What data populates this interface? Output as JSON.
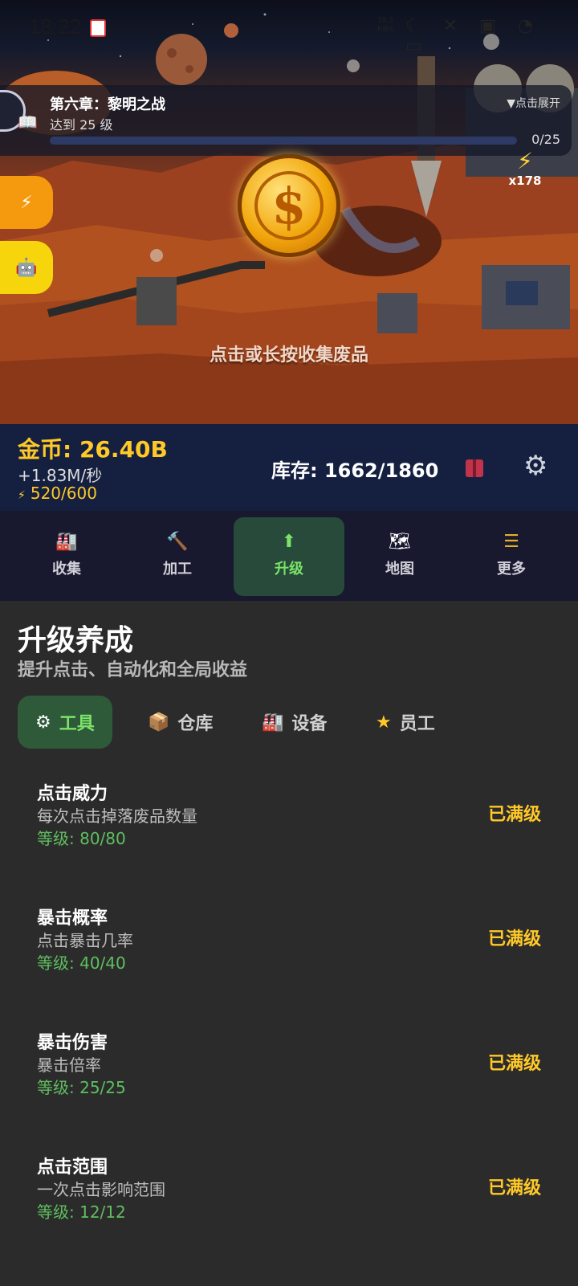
{
  "status_bar": {
    "time": "18:22",
    "net_speed_top": "19.3",
    "net_speed_bottom": "KB/s"
  },
  "chapter": {
    "title": "第六章：黎明之战",
    "goal": "达到 25 级",
    "expand_label": "▼点击展开",
    "progress_text": "0/25",
    "progress_fraction": 0
  },
  "energy_boost": {
    "multiplier": "x178"
  },
  "scene": {
    "collect_hint": "点击或长按收集废品"
  },
  "stats": {
    "gold": "金币: 26.40B",
    "rate": "+1.83M/秒",
    "energy": "520/600",
    "stock": "库存: 1662/1860"
  },
  "nav": {
    "items": [
      {
        "label": "收集",
        "icon": "factory-icon"
      },
      {
        "label": "加工",
        "icon": "hammer-icon"
      },
      {
        "label": "升级",
        "icon": "up-arrow-icon"
      },
      {
        "label": "地图",
        "icon": "map-icon"
      },
      {
        "label": "更多",
        "icon": "menu-icon"
      }
    ],
    "active_index": 2
  },
  "panel": {
    "title": "升级养成",
    "subtitle": "提升点击、自动化和全局收益",
    "tabs": [
      {
        "label": "工具",
        "icon": "gear-icon"
      },
      {
        "label": "仓库",
        "icon": "box-icon"
      },
      {
        "label": "设备",
        "icon": "machine-icon"
      },
      {
        "label": "员工",
        "icon": "star-icon"
      }
    ],
    "active_tab": 0,
    "upgrades": [
      {
        "name": "点击威力",
        "desc": "每次点击掉落废品数量",
        "level": "等级: 80/80",
        "status": "已满级"
      },
      {
        "name": "暴击概率",
        "desc": "点击暴击几率",
        "level": "等级: 40/40",
        "status": "已满级"
      },
      {
        "name": "暴击伤害",
        "desc": "暴击倍率",
        "level": "等级: 25/25",
        "status": "已满级"
      },
      {
        "name": "点击范围",
        "desc": "一次点击影响范围",
        "level": "等级: 12/12",
        "status": "已满级"
      }
    ]
  },
  "colors": {
    "gold": "#ffc928",
    "green_active": "#7be36a",
    "level_green": "#5fbf5f",
    "nav_bg": "#18182e",
    "stats_bg": "#152040"
  }
}
